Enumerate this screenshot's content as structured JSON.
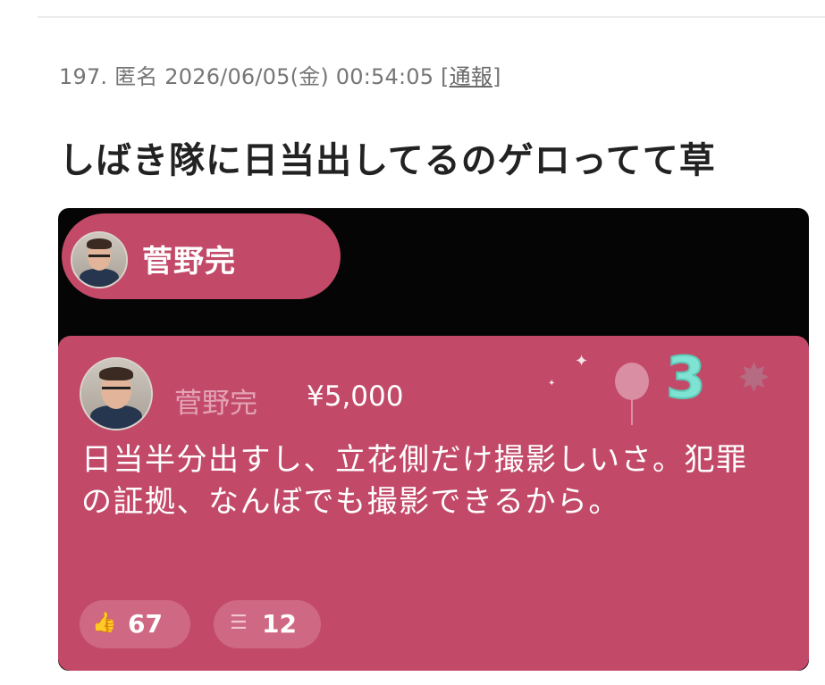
{
  "post": {
    "meta_prefix": "197. 匿名 2026/06/05(金) 00:54:05 [",
    "report_label": "通報",
    "meta_suffix": "]",
    "title": "しばき隊に日当出してるのゲロってて草"
  },
  "embed": {
    "pill_name": "菅野完",
    "card": {
      "user": "菅野完",
      "amount": "¥5,000",
      "message": "日当半分出すし、立花側だけ撮影しいさ。犯罪の証拠、なんぼでも撮影できるから。",
      "rank_badge": "3",
      "likes": "67",
      "replies": "12"
    },
    "icons": {
      "like": "thumbs-up-icon",
      "reply": "comment-icon",
      "balloon": "balloon-icon",
      "burst": "burst-icon"
    }
  }
}
